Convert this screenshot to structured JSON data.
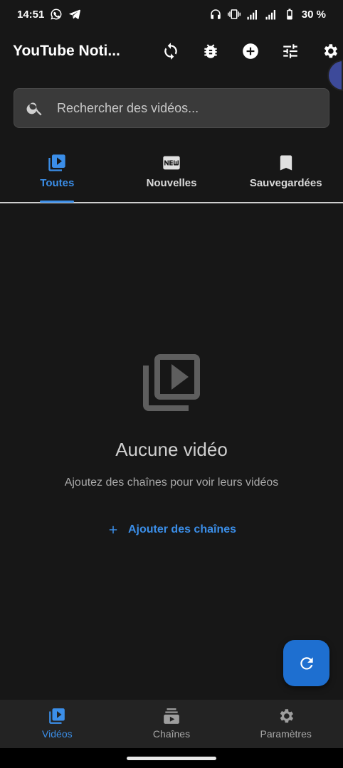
{
  "status_bar": {
    "time": "14:51",
    "battery": "30 %",
    "icons": [
      "whatsapp-icon",
      "telegram-icon",
      "headphones-icon",
      "vibrate-icon",
      "signal-4g-icon",
      "signal-icon",
      "battery-icon"
    ]
  },
  "app_bar": {
    "title": "YouTube Noti...",
    "actions": [
      "sync-icon",
      "bug-icon",
      "add-circle-icon",
      "tune-icon",
      "settings-icon"
    ]
  },
  "search": {
    "placeholder": "Rechercher des vidéos...",
    "value": ""
  },
  "tabs": [
    {
      "label": "Toutes",
      "icon": "video-library-icon",
      "active": true
    },
    {
      "label": "Nouvelles",
      "icon": "new-badge-icon",
      "active": false
    },
    {
      "label": "Sauvegardées",
      "icon": "bookmark-icon",
      "active": false
    }
  ],
  "empty_state": {
    "title": "Aucune vidéo",
    "subtitle": "Ajoutez des chaînes pour voir leurs vidéos",
    "button_label": "Ajouter des chaînes"
  },
  "fab": {
    "icon": "refresh-icon"
  },
  "bottom_nav": [
    {
      "label": "Vidéos",
      "icon": "video-library-icon",
      "active": true
    },
    {
      "label": "Chaînes",
      "icon": "subscriptions-icon",
      "active": false
    },
    {
      "label": "Paramètres",
      "icon": "settings-icon",
      "active": false
    }
  ],
  "colors": {
    "background": "#171717",
    "accent": "#3b8ee8",
    "fab": "#1e6fd0"
  }
}
